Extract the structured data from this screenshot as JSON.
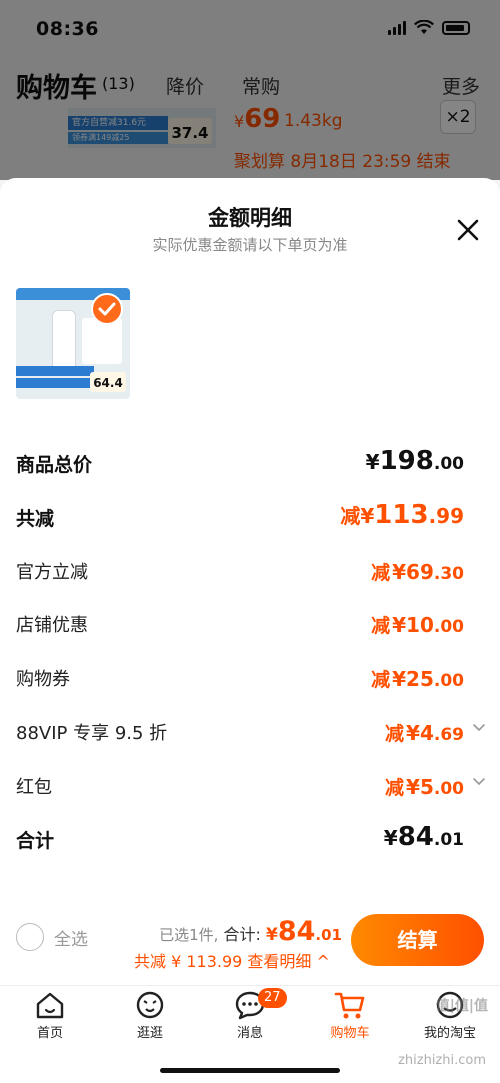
{
  "status_bar": {
    "time": "08:36"
  },
  "cart_header": {
    "title": "购物车",
    "count": "(13)",
    "tabs": [
      "降价",
      "常购"
    ],
    "more": "更多"
  },
  "background_item": {
    "img_promo1": "官方自营减31.6元",
    "img_promo2": "领券满149减25",
    "img_price": "37.4",
    "price_symbol": "¥",
    "price": "69",
    "weight": "1.43kg",
    "quantity": "×2",
    "deadline": "聚划算 8月18日 23:59 结束"
  },
  "sheet": {
    "title": "金额明细",
    "subtitle": "实际优惠金额请以下单页为准",
    "thumb_price": "64.4",
    "rows": [
      {
        "label": "商品总价",
        "prefix": "",
        "symbol": "¥",
        "int": "198",
        "dec": ".00"
      },
      {
        "label": "共减",
        "prefix": "减",
        "symbol": "¥",
        "int": "113",
        "dec": ".99"
      },
      {
        "label": "官方立减",
        "prefix": "减",
        "symbol": "¥",
        "int": "69",
        "dec": ".30"
      },
      {
        "label": "店铺优惠",
        "prefix": "减",
        "symbol": "¥",
        "int": "10",
        "dec": ".00"
      },
      {
        "label": "购物券",
        "prefix": "减",
        "symbol": "¥",
        "int": "25",
        "dec": ".00"
      },
      {
        "label": "88VIP 专享 9.5 折",
        "prefix": "减",
        "symbol": "¥",
        "int": "4",
        "dec": ".69"
      },
      {
        "label": "红包",
        "prefix": "减",
        "symbol": "¥",
        "int": "5",
        "dec": ".00"
      },
      {
        "label": "合计",
        "prefix": "",
        "symbol": "¥",
        "int": "84",
        "dec": ".01"
      }
    ]
  },
  "checkout": {
    "select_all": "全选",
    "selected": "已选1件,",
    "total_label": "合计:",
    "symbol": "¥",
    "total_int": "84",
    "total_dec": ".01",
    "reduce_text": "共减 ¥ 113.99 查看明细 ^",
    "button": "结算"
  },
  "tabbar": {
    "tabs": [
      {
        "label": "首页",
        "icon": "home-icon"
      },
      {
        "label": "逛逛",
        "icon": "browse-icon"
      },
      {
        "label": "消息",
        "icon": "message-icon",
        "badge": "27"
      },
      {
        "label": "购物车",
        "icon": "cart-icon"
      },
      {
        "label": "我的淘宝",
        "icon": "profile-icon"
      }
    ]
  },
  "watermark": {
    "main": "值|值|值",
    "sub": "zhizhizhi.com"
  },
  "colors": {
    "accent": "#ff5000",
    "button_start": "#ff8a00",
    "button_end": "#ff4f00"
  }
}
